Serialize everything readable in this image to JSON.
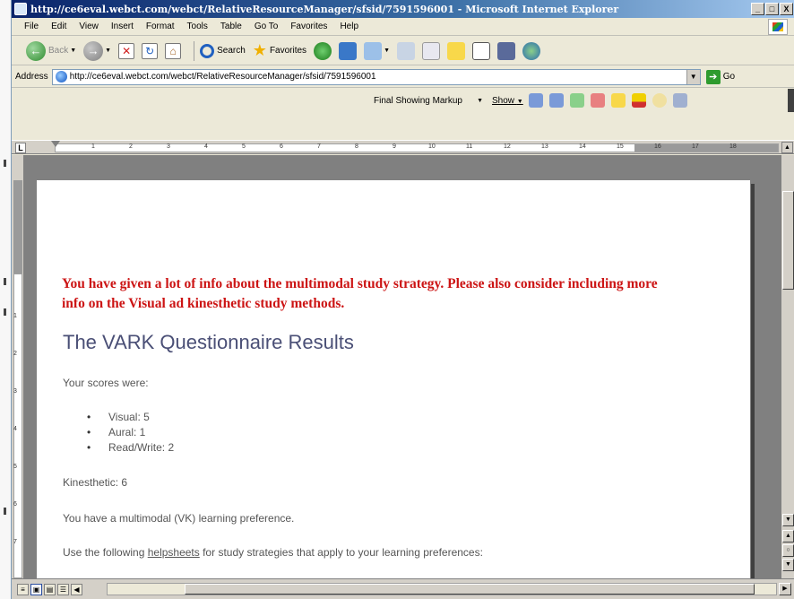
{
  "window": {
    "title": "http://ce6eval.webct.com/webct/RelativeResourceManager/sfsid/7591596001 - Microsoft Internet Explorer",
    "controls": [
      "_",
      "□",
      "X"
    ]
  },
  "menubar": {
    "items": [
      "File",
      "Edit",
      "View",
      "Insert",
      "Format",
      "Tools",
      "Table",
      "Go To",
      "Favorites",
      "Help"
    ]
  },
  "toolbar": {
    "back_label": "Back",
    "search_label": "Search",
    "favorites_label": "Favorites"
  },
  "address": {
    "label": "Address",
    "url": "http://ce6eval.webct.com/webct/RelativeResourceManager/sfsid/7591596001",
    "go_label": "Go"
  },
  "review": {
    "display_mode": "Final Showing Markup",
    "show_label": "Show"
  },
  "ruler": {
    "ticks": [
      "1",
      "2",
      "3",
      "4",
      "5",
      "6",
      "7",
      "8",
      "9",
      "10",
      "11",
      "12",
      "13",
      "14",
      "15",
      "16",
      "17",
      "18"
    ],
    "vticks": [
      "1",
      "2",
      "3",
      "4",
      "5",
      "6",
      "7"
    ]
  },
  "document": {
    "comment": "You have given a lot of info about the multimodal study strategy. Please also consider including more info on the Visual ad kinesthetic study methods.",
    "title": "The VARK Questionnaire Results",
    "scores_intro": "Your scores were:",
    "scores": [
      "Visual: 5",
      "Aural: 1",
      "Read/Write: 2"
    ],
    "kinesthetic": "Kinesthetic: 6",
    "preference": "You have a multimodal (VK) learning preference.",
    "helpsheets_before": "Use the following ",
    "helpsheets_link": "helpsheets",
    "helpsheets_after": " for study strategies that apply to your learning preferences:"
  },
  "colors": {
    "title_bar": "#0a246a",
    "comment_text": "#cc1414",
    "heading_text": "#4a4f76",
    "chrome": "#ece9d8"
  }
}
